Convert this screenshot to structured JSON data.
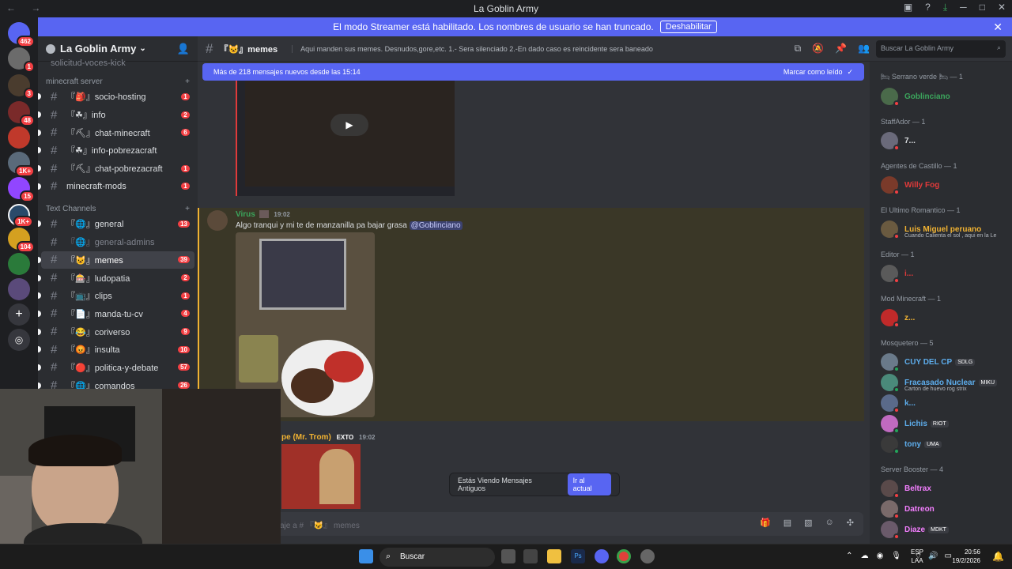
{
  "window": {
    "title": "La Goblin Army",
    "nav": "←  →"
  },
  "banner": {
    "text": "El modo Streamer está habilitado. Los nombres de usuario se han truncado.",
    "button": "Deshabilitar",
    "close": "✕"
  },
  "server_badges": [
    "462",
    "1",
    "3",
    "48",
    "1K+",
    "15",
    "1K+",
    "104"
  ],
  "sidebar": {
    "guild": "La Goblin Army",
    "partial_top": "solicitud-voces-kick",
    "categories": [
      "minecraft server",
      "Text Channels"
    ],
    "minecraft_channels": [
      {
        "label": "『🎒』socio-hosting",
        "count": "1"
      },
      {
        "label": "『☘』info",
        "count": "2"
      },
      {
        "label": "『⛏』chat-minecraft",
        "count": "6"
      },
      {
        "label": "『☘』info-pobrezacraft",
        "count": ""
      },
      {
        "label": "『⛏』chat-pobrezacraft",
        "count": "1"
      },
      {
        "label": "minecraft-mods",
        "count": "1"
      }
    ],
    "text_channels": [
      {
        "label": "『🌐』general",
        "count": "13"
      },
      {
        "label": "『🌐』general-admins",
        "count": ""
      },
      {
        "label": "『😺』memes",
        "count": "39"
      },
      {
        "label": "『🎰』ludopatia",
        "count": "2"
      },
      {
        "label": "『📺』clips",
        "count": "1"
      },
      {
        "label": "『📄』manda-tu-cv",
        "count": "4"
      },
      {
        "label": "『😂』coriverso",
        "count": "9"
      },
      {
        "label": "『😡』insulta",
        "count": "10"
      },
      {
        "label": "『🔴』politica-y-debate",
        "count": "57"
      },
      {
        "label": "『🌐』comandos",
        "count": "26"
      }
    ]
  },
  "header": {
    "channel": "『😺』memes",
    "topic": "Aqui manden sus memes. Desnudos,gore,etc. 1.- Sera silenciado 2.-En dado caso es reincidente sera baneado",
    "search_placeholder": "Buscar La Goblin Army"
  },
  "chat": {
    "new_messages": "Más de 218 mensajes nuevos desde las 15:14",
    "mark_read": "Marcar como leído",
    "msg1": {
      "author": "Virus",
      "time": "19:02",
      "text_before": "Algo tranqui y mi te de manzanilla pa bajar grasa ",
      "mention": "@Goblinciano"
    },
    "msg2": {
      "author": "pe (Mr. Trom)",
      "tag": "EXTO",
      "time": "19:02"
    },
    "old_messages": "Estás Viendo Mensajes Antiguos",
    "jump": "Ir al actual",
    "composer_placeholder": "aje a # 『😺』 memes"
  },
  "members": {
    "groups": [
      {
        "title": "🛏 Serrano verde 🛏 — 1",
        "members": [
          {
            "name": "Goblinciano",
            "color": "#3ba55c",
            "sub": "",
            "tag": ""
          }
        ]
      },
      {
        "title": "StaffAdor — 1",
        "members": [
          {
            "name": "7...",
            "color": "#dbdee1",
            "sub": "",
            "tag": ""
          }
        ]
      },
      {
        "title": "Agentes de Castillo — 1",
        "members": [
          {
            "name": "Willy Fog",
            "color": "#e03a3a",
            "sub": "",
            "tag": ""
          }
        ]
      },
      {
        "title": "El Ultimo Romantico — 1",
        "members": [
          {
            "name": "Luis Miguel peruano",
            "color": "#f0b232",
            "sub": "Cuando Calienta el sol , aqui en la Le",
            "tag": ""
          }
        ]
      },
      {
        "title": "Editor — 1",
        "members": [
          {
            "name": "i...",
            "color": "#e03a3a",
            "sub": "",
            "tag": ""
          }
        ]
      },
      {
        "title": "Mod Minecraft — 1",
        "members": [
          {
            "name": "z...",
            "color": "#f0b232",
            "sub": "",
            "tag": ""
          }
        ]
      },
      {
        "title": "Mosquetero — 5",
        "members": [
          {
            "name": "CUY DEL CP",
            "color": "#5dadec",
            "sub": "",
            "tag": "SDLG"
          },
          {
            "name": "Fracasado Nuclear",
            "color": "#5dadec",
            "sub": "Carton de huevo rog strix",
            "tag": "MIKU"
          },
          {
            "name": "k...",
            "color": "#5dadec",
            "sub": "",
            "tag": ""
          },
          {
            "name": "Lichis",
            "color": "#5dadec",
            "sub": "",
            "tag": "RIOT"
          },
          {
            "name": "tony",
            "color": "#5dadec",
            "sub": "",
            "tag": "UMA"
          }
        ]
      },
      {
        "title": "Server Booster — 4",
        "members": [
          {
            "name": "Beltrax",
            "color": "#f47fff",
            "sub": "",
            "tag": ""
          },
          {
            "name": "Datreon",
            "color": "#f47fff",
            "sub": "",
            "tag": ""
          },
          {
            "name": "Diaze",
            "color": "#f47fff",
            "sub": "",
            "tag": "MDKT"
          }
        ]
      }
    ]
  },
  "taskbar": {
    "search": "Buscar",
    "lang": "ESP\nLAA",
    "time": "20:56",
    "date": "19/2/2026"
  }
}
